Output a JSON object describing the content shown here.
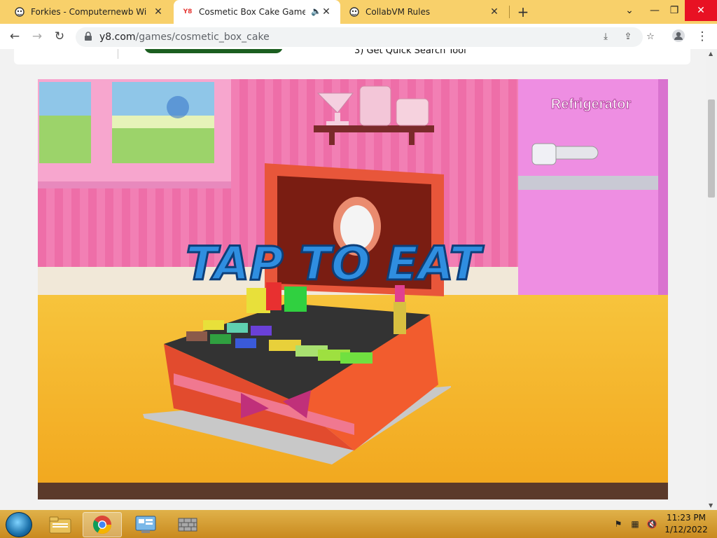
{
  "browser": {
    "tabs": [
      {
        "title": "Forkies - Computernewb Wiki",
        "favicon": "wiki-icon"
      },
      {
        "title": "Cosmetic Box Cake Game - P",
        "favicon": "y8-icon",
        "favicon_text": "Y8",
        "audio": "speaker-icon",
        "active": true
      },
      {
        "title": "CollabVM Rules",
        "favicon": "wiki-icon"
      }
    ],
    "new_tab": "+",
    "address": {
      "host": "y8.com",
      "path": "/games/cosmetic_box_cake"
    }
  },
  "page": {
    "tip_text": "3)  Get Quick Search Tool"
  },
  "game": {
    "refrigerator_label": "Refrigerator",
    "cta": "TAP TO EAT"
  },
  "taskbar": {
    "time": "11:23 PM",
    "date": "1/12/2022"
  },
  "colors": {
    "chrome_frame": "#f8d06a",
    "taskbar": "#d9a035",
    "cta_fill": "#2f8ee0",
    "wall": "#f07ab0",
    "table": "#f5b82e"
  }
}
